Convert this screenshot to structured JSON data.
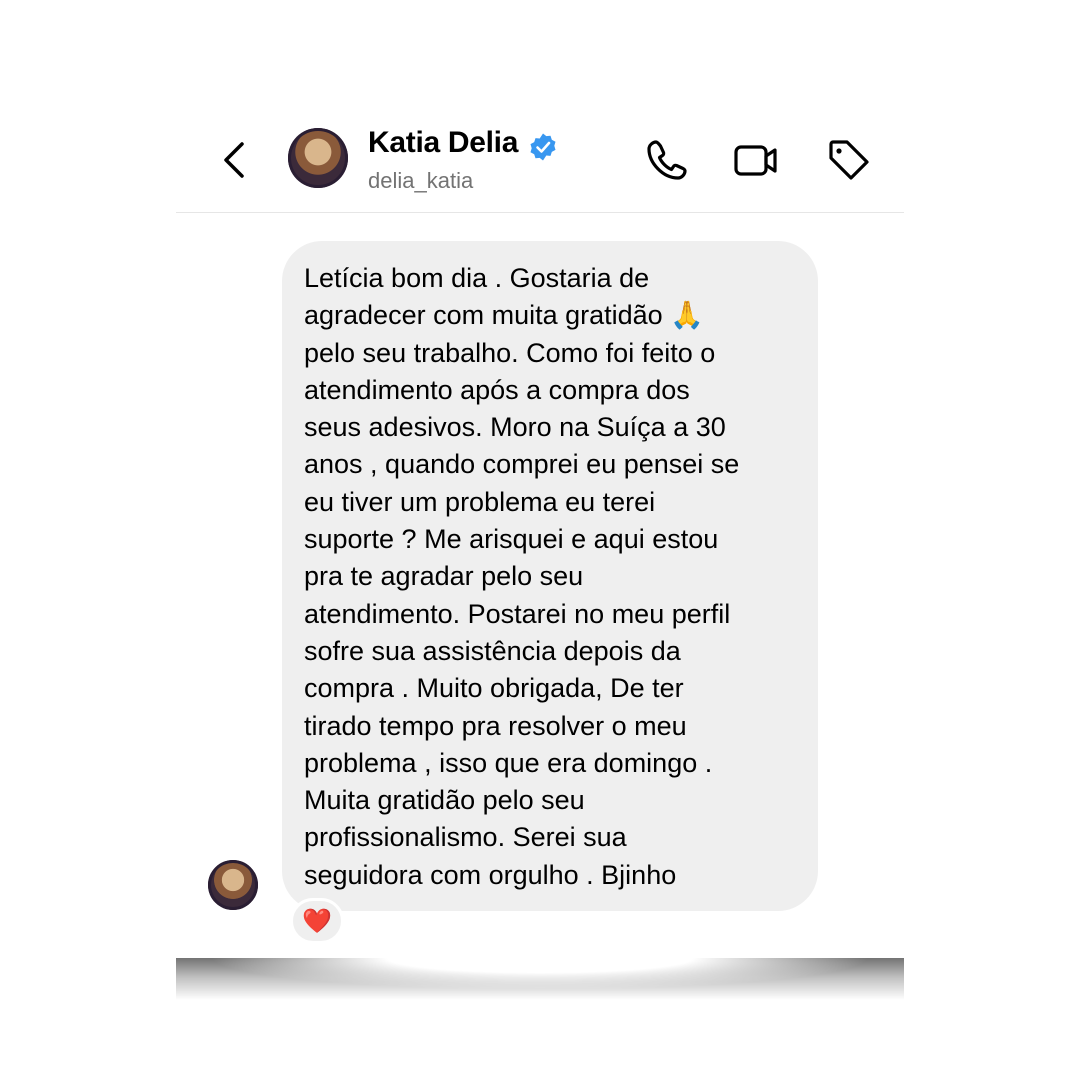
{
  "header": {
    "name": "Katia Delia",
    "handle": "delia_katia",
    "verified": true,
    "icons": [
      "back-icon",
      "phone-icon",
      "video-icon",
      "tag-icon"
    ]
  },
  "message": {
    "text": "Letícia bom dia . Gostaria de\nagradecer com muita gratidão 🙏\npelo seu trabalho. Como foi feito o\natendimento após a compra dos\nseus adesivos. Moro na Suíça a 30\nanos , quando comprei eu pensei se\neu tiver um problema eu terei\nsuporte ? Me arisquei e aqui estou\npra te agradar pelo seu\natendimento. Postarei no meu perfil\nsofre sua assistência depois da\ncompra . Muito obrigada,  De ter\ntirado tempo pra resolver o meu\nproblema , isso que era domingo .\nMuita gratidão pelo seu\nprofissionalismo. Serei sua\nseguidora com orgulho . Bjinho",
    "reaction": "❤️"
  },
  "colors": {
    "bubble": "#efefef",
    "verified": "#3897f0",
    "handle": "#737373"
  }
}
